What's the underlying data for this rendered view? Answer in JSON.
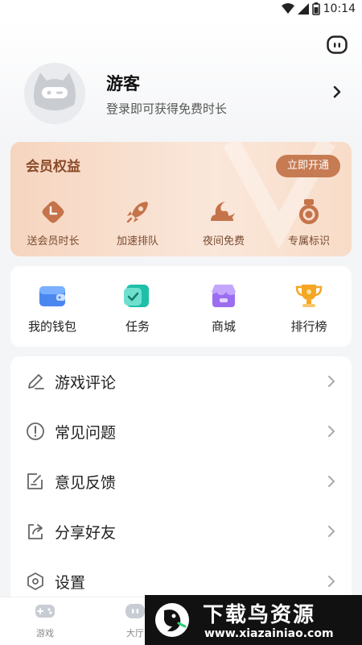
{
  "status": {
    "time": "10:14"
  },
  "user": {
    "name": "游客",
    "subtitle": "登录即可获得免费时长"
  },
  "vip": {
    "title": "会员权益",
    "button": "立即开通",
    "items": [
      {
        "label": "送会员时长",
        "icon": "clock-badge-icon"
      },
      {
        "label": "加速排队",
        "icon": "rocket-icon"
      },
      {
        "label": "夜间免费",
        "icon": "moon-cloud-icon"
      },
      {
        "label": "专属标识",
        "icon": "medal-icon"
      }
    ]
  },
  "quick": {
    "items": [
      {
        "label": "我的钱包",
        "icon": "wallet-icon"
      },
      {
        "label": "任务",
        "icon": "task-icon"
      },
      {
        "label": "商城",
        "icon": "shop-icon"
      },
      {
        "label": "排行榜",
        "icon": "trophy-icon"
      }
    ]
  },
  "menu": {
    "items": [
      {
        "label": "游戏评论",
        "icon": "pencil-icon"
      },
      {
        "label": "常见问题",
        "icon": "exclamation-circle-icon"
      },
      {
        "label": "意见反馈",
        "icon": "feedback-icon"
      },
      {
        "label": "分享好友",
        "icon": "share-icon"
      },
      {
        "label": "设置",
        "icon": "settings-hex-icon"
      }
    ]
  },
  "tabs": [
    {
      "label": "游戏",
      "icon": "gamepad-icon"
    },
    {
      "label": "大厅",
      "icon": "chat-hall-icon"
    }
  ],
  "watermark": {
    "title": "下载鸟资源",
    "url": "www.xiazainiao.com"
  },
  "colors": {
    "vip_accent": "#c77b52",
    "vip_text": "#8a4a28",
    "page_bg": "#f4f5f7"
  }
}
